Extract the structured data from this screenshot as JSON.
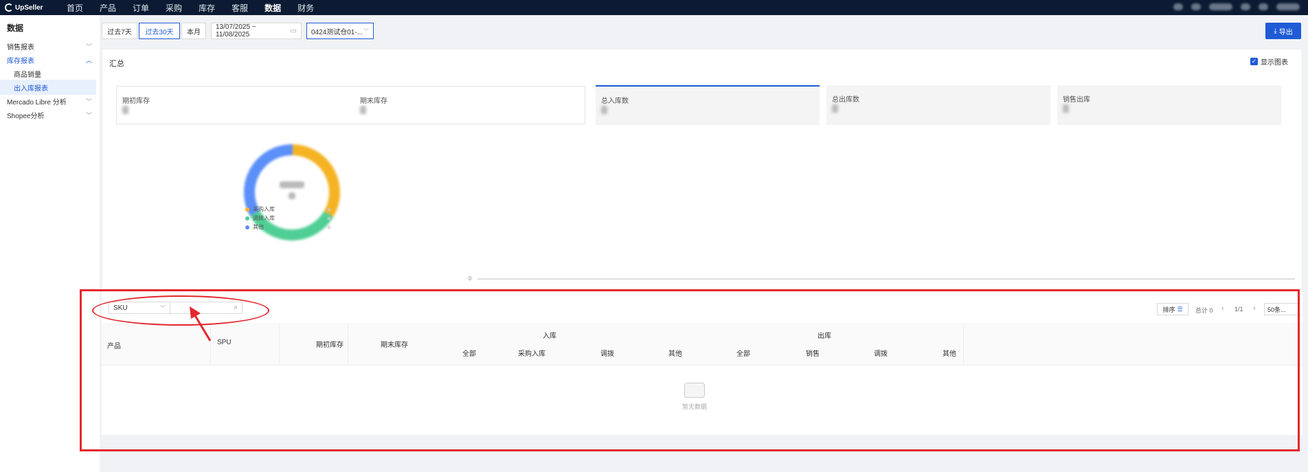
{
  "topbar": {
    "brand": "UpSeller",
    "nav": [
      "首页",
      "产品",
      "订单",
      "采购",
      "库存",
      "客服",
      "数据",
      "财务"
    ],
    "active_nav": "数据"
  },
  "sidebar": {
    "title": "数据",
    "items": [
      {
        "label": "销售报表"
      },
      {
        "label": "库存报表"
      },
      {
        "label": "商品销量"
      },
      {
        "label": "出入库报表"
      },
      {
        "label": "Mercado Libre 分析"
      },
      {
        "label": "Shopee分析"
      }
    ]
  },
  "toolbar": {
    "range_buttons": [
      "过去7天",
      "过去30天",
      "本月"
    ],
    "date_range": "13/07/2025 ~ 11/08/2025",
    "warehouse": "0424测试仓01-...",
    "export_label": "导出"
  },
  "summary": {
    "title": "汇总",
    "show_chart_label": "显示图表",
    "stats": [
      {
        "label": "期初库存"
      },
      {
        "label": "期末库存"
      },
      {
        "label": "总入库数"
      },
      {
        "label": "总出库数"
      },
      {
        "label": "销售出库"
      }
    ],
    "legend": [
      "采购入库",
      "调拨入库",
      "其他"
    ],
    "axis_zero": "0"
  },
  "table": {
    "search_field": "SKU",
    "sort_label": "排序",
    "total_label": "总计 0",
    "page": "1/1",
    "page_size": "50条...",
    "headers": {
      "product": "产品",
      "spu": "SPU",
      "opening": "期初库存",
      "closing": "期末库存",
      "inbound": "入库",
      "outbound": "出库",
      "in_sub": [
        "全部",
        "采购入库",
        "调拨",
        "其他"
      ],
      "out_sub": [
        "全部",
        "销售",
        "调拨",
        "其他"
      ]
    },
    "empty_text": "暂无数据"
  },
  "colors": {
    "accent": "#1f5bd6",
    "donut_orange": "#f5b324",
    "donut_green": "#4fcf95",
    "donut_blue": "#5b8ff9",
    "annotation": "#e5262d"
  }
}
